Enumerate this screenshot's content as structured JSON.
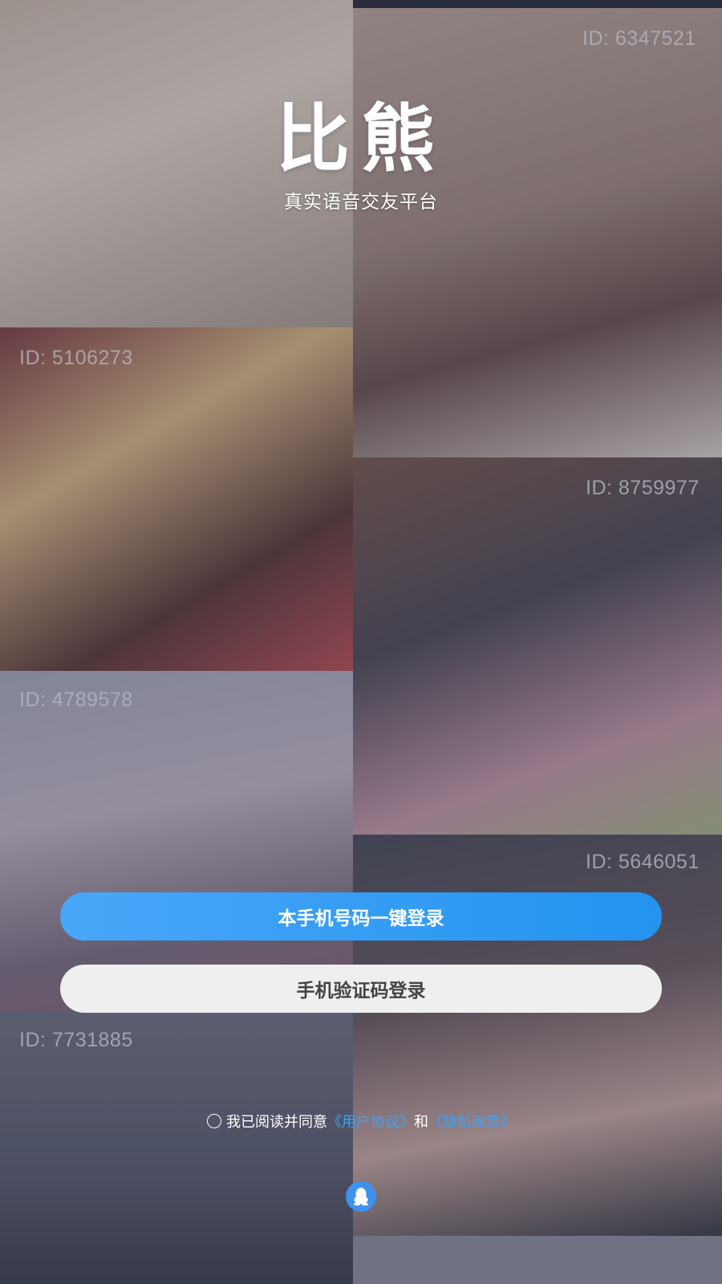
{
  "brand": {
    "logo_text": "比熊",
    "slogan": "真实语音交友平台"
  },
  "gallery": {
    "tiles": [
      {
        "id_label": ""
      },
      {
        "id_label": "ID: 6347521"
      },
      {
        "id_label": "ID: 5106273"
      },
      {
        "id_label": "ID: 8759977"
      },
      {
        "id_label": "ID: 4789578"
      },
      {
        "id_label": "ID: 5646051"
      },
      {
        "id_label": "ID: 7731885"
      },
      {
        "id_label": ""
      }
    ]
  },
  "login": {
    "one_click_label": "本手机号码一键登录",
    "sms_label": "手机验证码登录"
  },
  "agreement": {
    "prefix": "我已阅读并同意",
    "user_agreement": "《用户协议》",
    "and": "和",
    "privacy_policy": "《隐私政策》"
  },
  "third_party": {
    "icon": "qq-penguin-icon"
  },
  "colors": {
    "primary_blue": "#2393ef",
    "link_blue": "#3da2f7"
  }
}
